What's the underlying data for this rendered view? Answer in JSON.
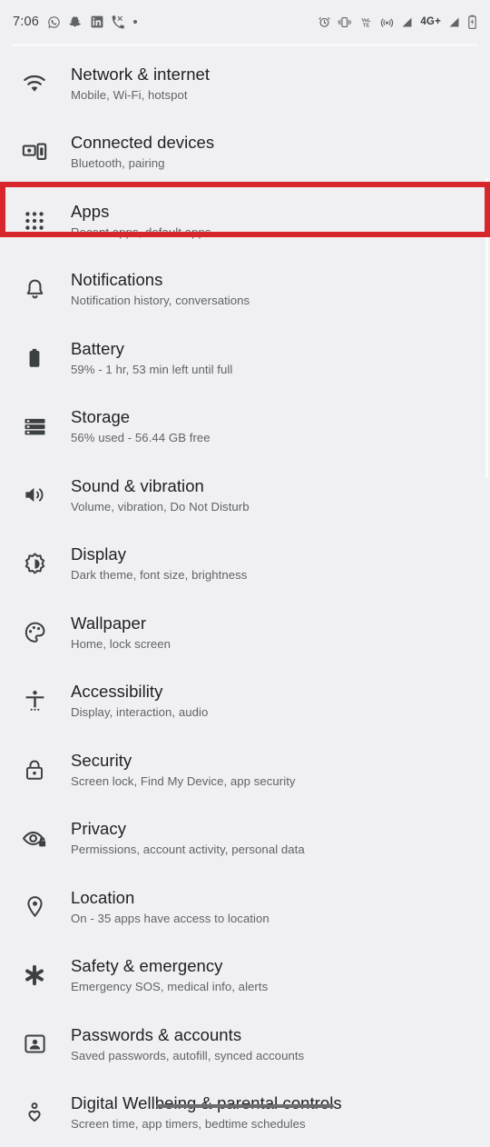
{
  "status_bar": {
    "time": "7:06",
    "left_icons": [
      {
        "name": "whatsapp-icon",
        "label": "WhatsApp"
      },
      {
        "name": "snapchat-icon",
        "label": "Snapchat"
      },
      {
        "name": "linkedin-icon",
        "label": "LinkedIn"
      },
      {
        "name": "missed-call-icon",
        "label": "Missed call"
      },
      {
        "name": "more-notifications-dot",
        "label": "More notifications"
      }
    ],
    "right_icons": [
      {
        "name": "alarm-icon",
        "label": "Alarm set"
      },
      {
        "name": "vibrate-icon",
        "label": "Ringer vibrate"
      },
      {
        "name": "volte-icon",
        "label": "VoLTE"
      },
      {
        "name": "hotspot-icon",
        "label": "Hotspot"
      },
      {
        "name": "signal-sim1-icon",
        "label": "Signal SIM 1"
      },
      {
        "name": "network-type-label",
        "label": "4G+"
      },
      {
        "name": "signal-sim2-icon",
        "label": "Signal SIM 2"
      },
      {
        "name": "battery-icon",
        "label": "Battery charging"
      }
    ],
    "network_type": "4G+"
  },
  "highlight": {
    "color": "#d8272c",
    "target": "Apps"
  },
  "settings": {
    "items": [
      {
        "icon": "wifi-icon",
        "title": "Network & internet",
        "subtitle": "Mobile, Wi-Fi, hotspot"
      },
      {
        "icon": "connected-devices-icon",
        "title": "Connected devices",
        "subtitle": "Bluetooth, pairing"
      },
      {
        "icon": "apps-grid-icon",
        "title": "Apps",
        "subtitle": "Recent apps, default apps"
      },
      {
        "icon": "bell-icon",
        "title": "Notifications",
        "subtitle": "Notification history, conversations"
      },
      {
        "icon": "battery-icon",
        "title": "Battery",
        "subtitle": "59% - 1 hr, 53 min left until full"
      },
      {
        "icon": "storage-icon",
        "title": "Storage",
        "subtitle": "56% used - 56.44 GB free"
      },
      {
        "icon": "volume-icon",
        "title": "Sound & vibration",
        "subtitle": "Volume, vibration, Do Not Disturb"
      },
      {
        "icon": "brightness-icon",
        "title": "Display",
        "subtitle": "Dark theme, font size, brightness"
      },
      {
        "icon": "palette-icon",
        "title": "Wallpaper",
        "subtitle": "Home, lock screen"
      },
      {
        "icon": "accessibility-icon",
        "title": "Accessibility",
        "subtitle": "Display, interaction, audio"
      },
      {
        "icon": "lock-icon",
        "title": "Security",
        "subtitle": "Screen lock, Find My Device, app security"
      },
      {
        "icon": "privacy-eye-icon",
        "title": "Privacy",
        "subtitle": "Permissions, account activity, personal data"
      },
      {
        "icon": "location-pin-icon",
        "title": "Location",
        "subtitle": "On - 35 apps have access to location"
      },
      {
        "icon": "emergency-star-icon",
        "title": "Safety & emergency",
        "subtitle": "Emergency SOS, medical info, alerts"
      },
      {
        "icon": "account-badge-icon",
        "title": "Passwords & accounts",
        "subtitle": "Saved passwords, autofill, synced accounts"
      },
      {
        "icon": "wellbeing-icon",
        "title": "Digital Wellbeing & parental controls",
        "subtitle": "Screen time, app timers, bedtime schedules"
      }
    ]
  }
}
